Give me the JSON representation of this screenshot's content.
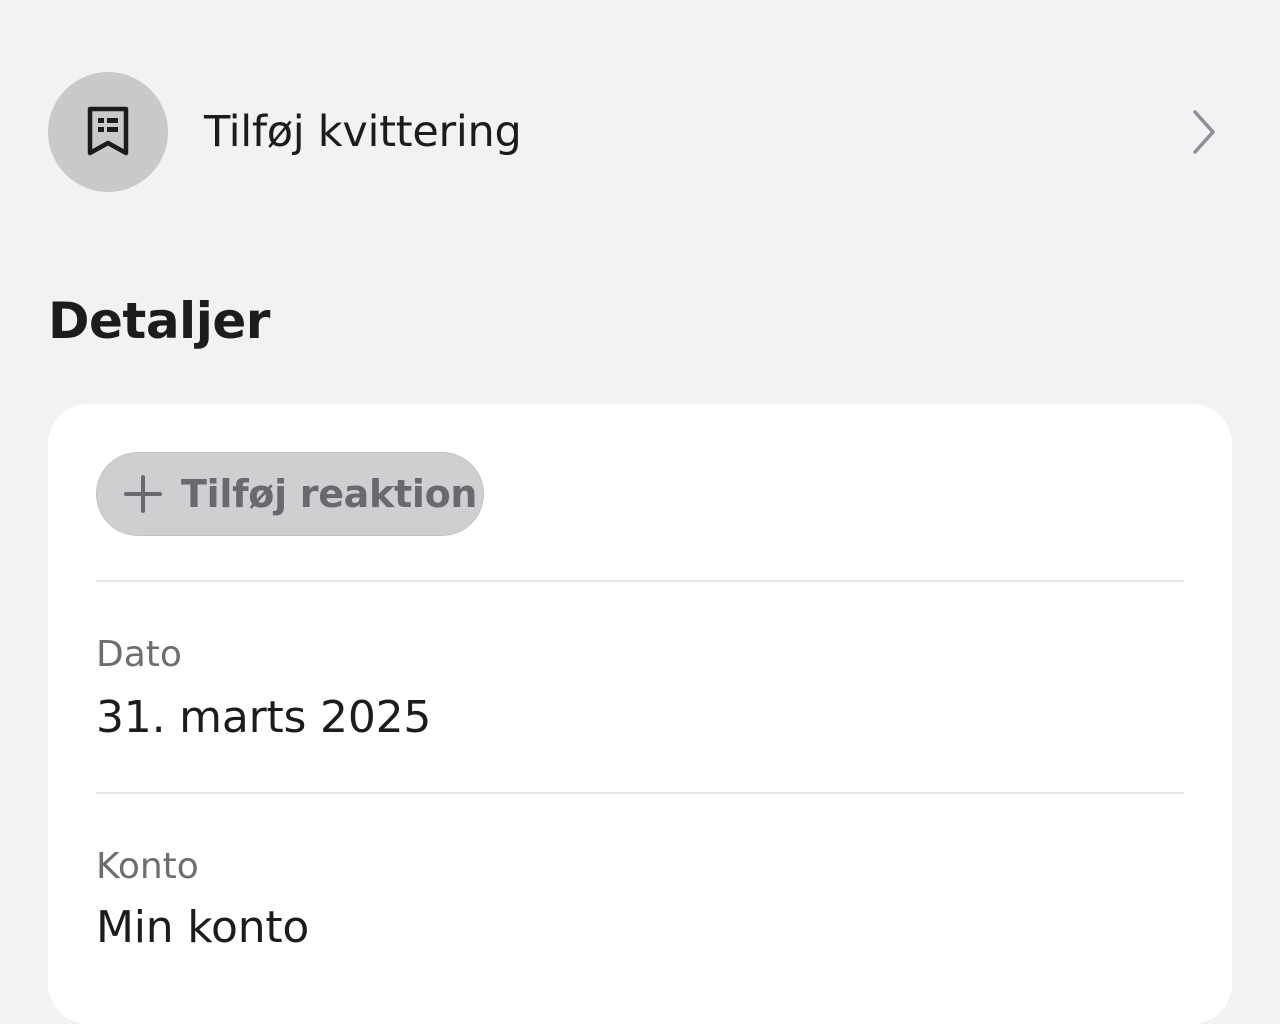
{
  "receipt": {
    "label": "Tilføj kvittering",
    "icon": "receipt-icon",
    "chevron_icon": "chevron-right-icon"
  },
  "details": {
    "title": "Detaljer",
    "reaction_button": {
      "icon": "plus-icon",
      "label": "Tilføj reaktion"
    },
    "fields": [
      {
        "label": "Dato",
        "value": "31. marts 2025"
      },
      {
        "label": "Konto",
        "value": "Min konto"
      }
    ]
  },
  "colors": {
    "background": "#f2f2f4",
    "card": "#ffffff",
    "icon_circle": "#c9c9cc",
    "secondary_text": "#6d6d72"
  }
}
